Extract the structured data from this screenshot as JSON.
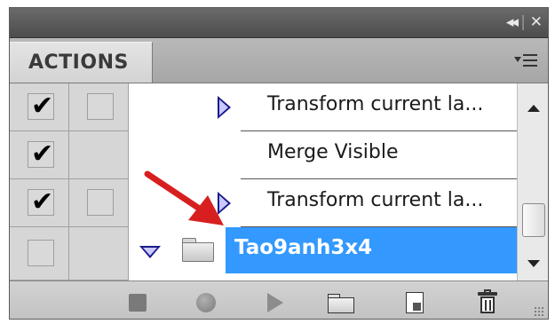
{
  "panel": {
    "tab_label": "ACTIONS",
    "title_controls": {
      "collapse": "◂◂",
      "separator": "|",
      "close": "✕"
    }
  },
  "rows": [
    {
      "checked": true,
      "dialog_box": true,
      "has_play_triangle": true,
      "label": "Transform current la..."
    },
    {
      "checked": true,
      "dialog_box": false,
      "has_play_triangle": false,
      "label": "Merge Visible"
    },
    {
      "checked": true,
      "dialog_box": true,
      "has_play_triangle": true,
      "label": "Transform current la..."
    },
    {
      "checked": false,
      "dialog_box": false,
      "is_set": true,
      "expanded": true,
      "label": "Tao9anh3x4",
      "selected": true
    }
  ],
  "checkmark": "✔",
  "colors": {
    "selection": "#3399ff",
    "annotation_arrow": "#d81f1f",
    "triangle": "#1a1a8a"
  },
  "toolbar": {
    "icons": [
      "stop-icon",
      "record-icon",
      "play-icon",
      "new-set-icon",
      "new-action-icon",
      "delete-icon"
    ]
  }
}
